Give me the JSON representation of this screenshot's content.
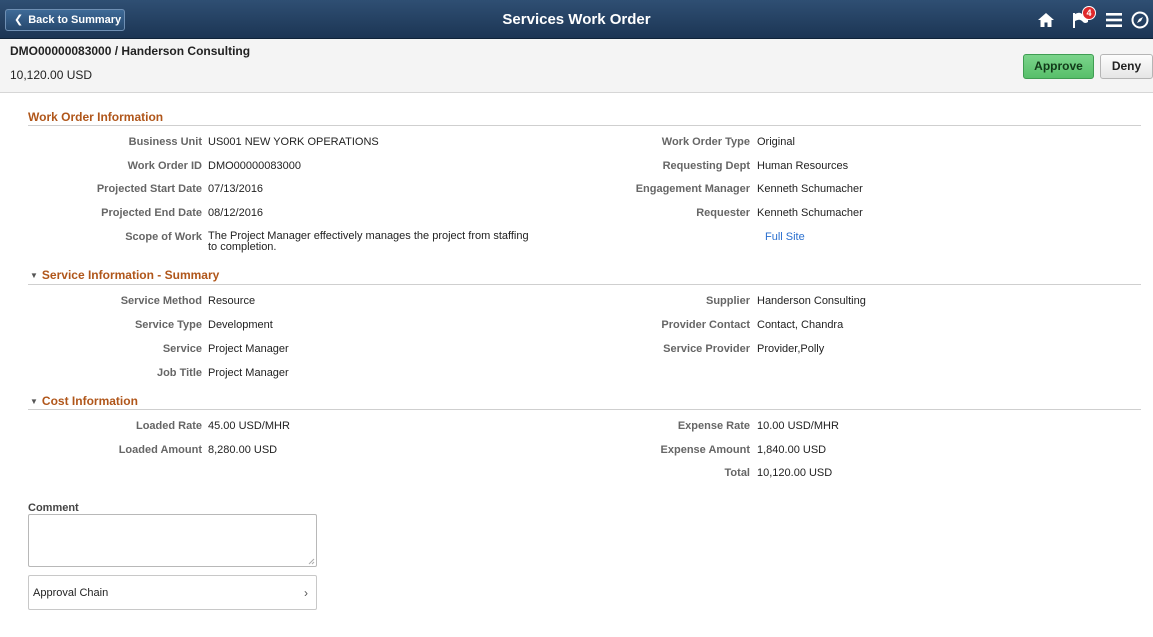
{
  "banner": {
    "back_label": "Back to Summary",
    "title": "Services Work Order",
    "notification_count": "4",
    "icons": [
      "home-icon",
      "notification-flag-icon",
      "menu-icon",
      "navbar-icon"
    ]
  },
  "header": {
    "work_order": "DMO00000083000 / Handerson Consulting",
    "amount": "10,120.00  USD",
    "approve_label": "Approve",
    "deny_label": "Deny"
  },
  "work_order_info": {
    "title": "Work Order Information",
    "left": [
      {
        "label": "Business Unit",
        "value": "US001 NEW YORK OPERATIONS"
      },
      {
        "label": "Work Order ID",
        "value": "DMO00000083000"
      },
      {
        "label": "Projected Start Date",
        "value": "07/13/2016"
      },
      {
        "label": "Projected End Date",
        "value": "08/12/2016"
      },
      {
        "label": "Scope of Work",
        "value": "The Project Manager effectively manages the project from staffing to completion."
      }
    ],
    "right": [
      {
        "label": "Work Order Type",
        "value": "Original"
      },
      {
        "label": "Requesting Dept",
        "value": "Human Resources"
      },
      {
        "label": "Engagement Manager",
        "value": "Kenneth Schumacher"
      },
      {
        "label": "Requester",
        "value": "Kenneth Schumacher"
      }
    ],
    "full_site_link": "Full Site"
  },
  "service_info": {
    "title": "Service Information - Summary",
    "left": [
      {
        "label": "Service Method",
        "value": "Resource"
      },
      {
        "label": "Service Type",
        "value": "Development"
      },
      {
        "label": "Service",
        "value": "Project Manager"
      },
      {
        "label": "Job Title",
        "value": "Project Manager"
      }
    ],
    "right": [
      {
        "label": "Supplier",
        "value": "Handerson Consulting"
      },
      {
        "label": "Provider Contact",
        "value": "Contact, Chandra"
      },
      {
        "label": "Service Provider",
        "value": "Provider,Polly"
      }
    ]
  },
  "cost_info": {
    "title": "Cost Information",
    "left": [
      {
        "label": "Loaded Rate",
        "value": "45.00 USD/MHR"
      },
      {
        "label": "Loaded Amount",
        "value": "8,280.00 USD"
      }
    ],
    "right": [
      {
        "label": "Expense Rate",
        "value": "10.00 USD/MHR"
      },
      {
        "label": "Expense Amount",
        "value": "1,840.00 USD"
      },
      {
        "label": "Total",
        "value": "10,120.00 USD"
      }
    ]
  },
  "comment": {
    "label": "Comment",
    "value": ""
  },
  "approval_chain": {
    "label": "Approval Chain"
  },
  "colors": {
    "banner": "#2a4a6e",
    "section_title": "#b0561a",
    "approve": "#64c675",
    "link": "#2a6fcf"
  }
}
